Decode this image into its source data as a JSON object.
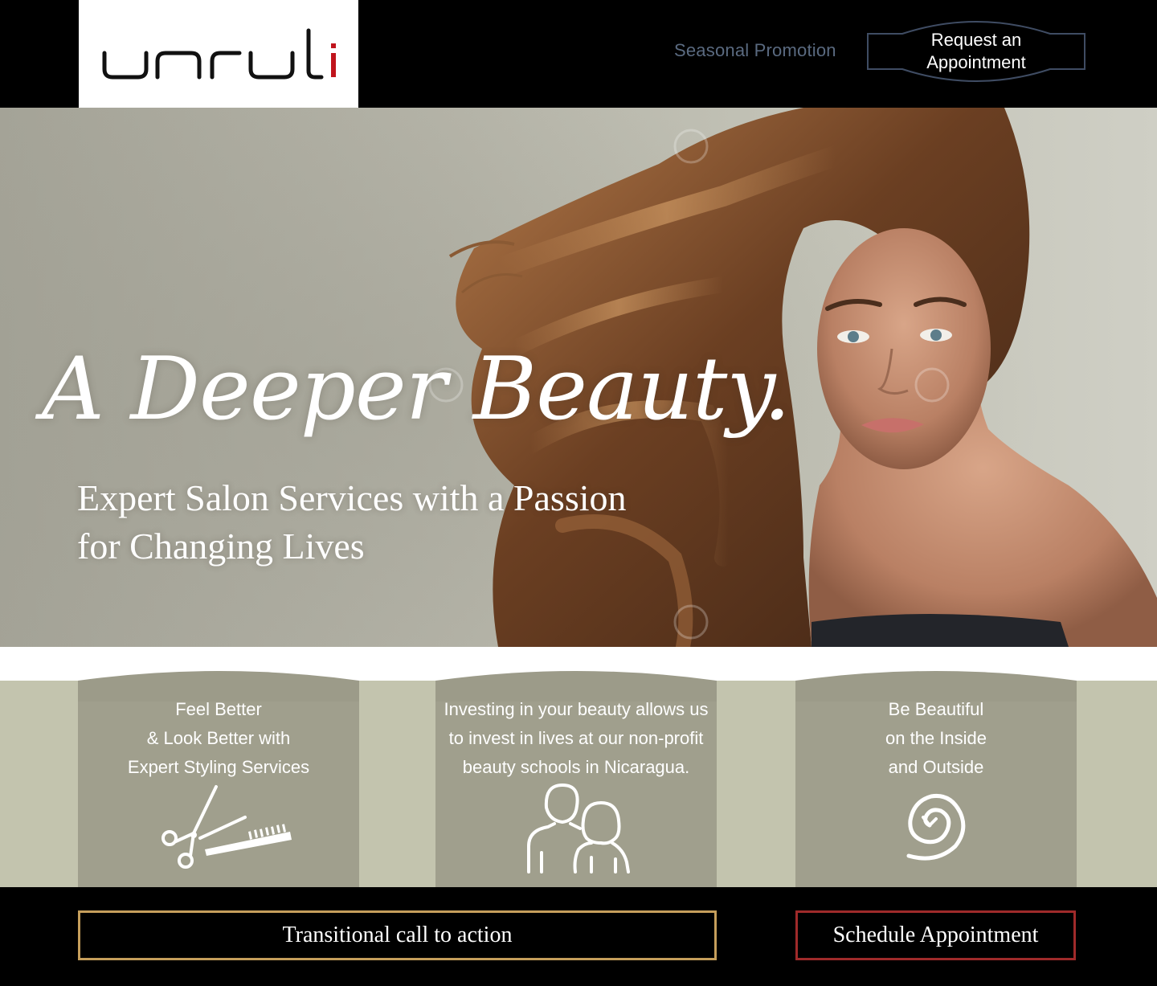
{
  "brand": {
    "name": "unruli",
    "accent_color": "#c0141c"
  },
  "header": {
    "promo_link": "Seasonal Promotion",
    "request_button_line1": "Request an",
    "request_button_line2": "Appointment"
  },
  "hero": {
    "tagline": "A Deeper Beauty.",
    "subhead_line1": "Expert Salon Services with a Passion",
    "subhead_line2": "for Changing Lives",
    "image": "woman-with-long-wavy-hair-photo"
  },
  "features": [
    {
      "text": "Feel Better\n& Look Better with\nExpert Styling Services",
      "icon": "scissors-comb-icon"
    },
    {
      "text": "Investing in your beauty allows us\nto invest in lives at our non-profit\nbeauty schools in Nicaragua.",
      "icon": "people-icon"
    },
    {
      "text": "Be Beautiful\non the Inside\nand Outside",
      "icon": "spiral-icon"
    }
  ],
  "footer": {
    "transitional_cta": "Transitional call to action",
    "schedule_cta": "Schedule Appointment"
  },
  "colors": {
    "header_bg": "#000000",
    "band_bg": "#c3c4ae",
    "card_bg": "#9c9b89",
    "promo_text": "#5a6a80",
    "transitional_border": "#c59e5b",
    "schedule_border": "#9f2a2a"
  }
}
